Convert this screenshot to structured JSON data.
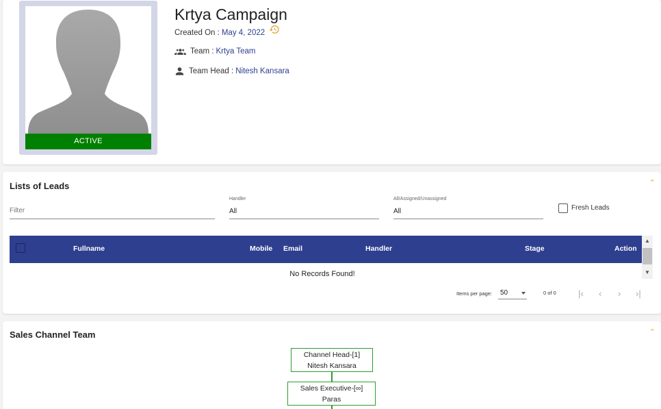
{
  "profile": {
    "status": "ACTIVE",
    "title": "Krtya Campaign",
    "created_label": "Created On : ",
    "created_date": "May 4, 2022",
    "team_label": "Team : ",
    "team_value": "Krtya Team",
    "team_head_label": "Team Head : ",
    "team_head_value": "Nitesh Kansara"
  },
  "leads": {
    "title": "Lists of Leads",
    "filter_placeholder": "Filter",
    "handler_label": "Handler",
    "handler_value": "All",
    "assigned_label": "All/Assigned/Unassigned",
    "assigned_value": "All",
    "fresh_label": "Fresh Leads",
    "columns": [
      "Fullname",
      "Mobile",
      "Email",
      "Handler",
      "Stage",
      "Action"
    ],
    "empty_text": "No Records Found!",
    "items_per_page_label": "Items per page:",
    "items_per_page_value": "50",
    "range_label": "0 of 0"
  },
  "sales": {
    "title": "Sales Channel Team",
    "nodes": [
      {
        "role": "Channel Head-[1]",
        "name": "Nitesh Kansara"
      },
      {
        "role": "Sales Executive-[∞]",
        "name": "Paras"
      }
    ]
  },
  "colors": {
    "active": "#008000",
    "table_header": "#2f3f8f",
    "link": "#2b3f8f",
    "accent": "#e8a33a",
    "org_border": "#2e9b2e"
  },
  "icons": [
    "history-icon",
    "team-icon",
    "person-icon",
    "chevron-up-icon",
    "first-page-icon",
    "prev-page-icon",
    "next-page-icon",
    "last-page-icon"
  ]
}
